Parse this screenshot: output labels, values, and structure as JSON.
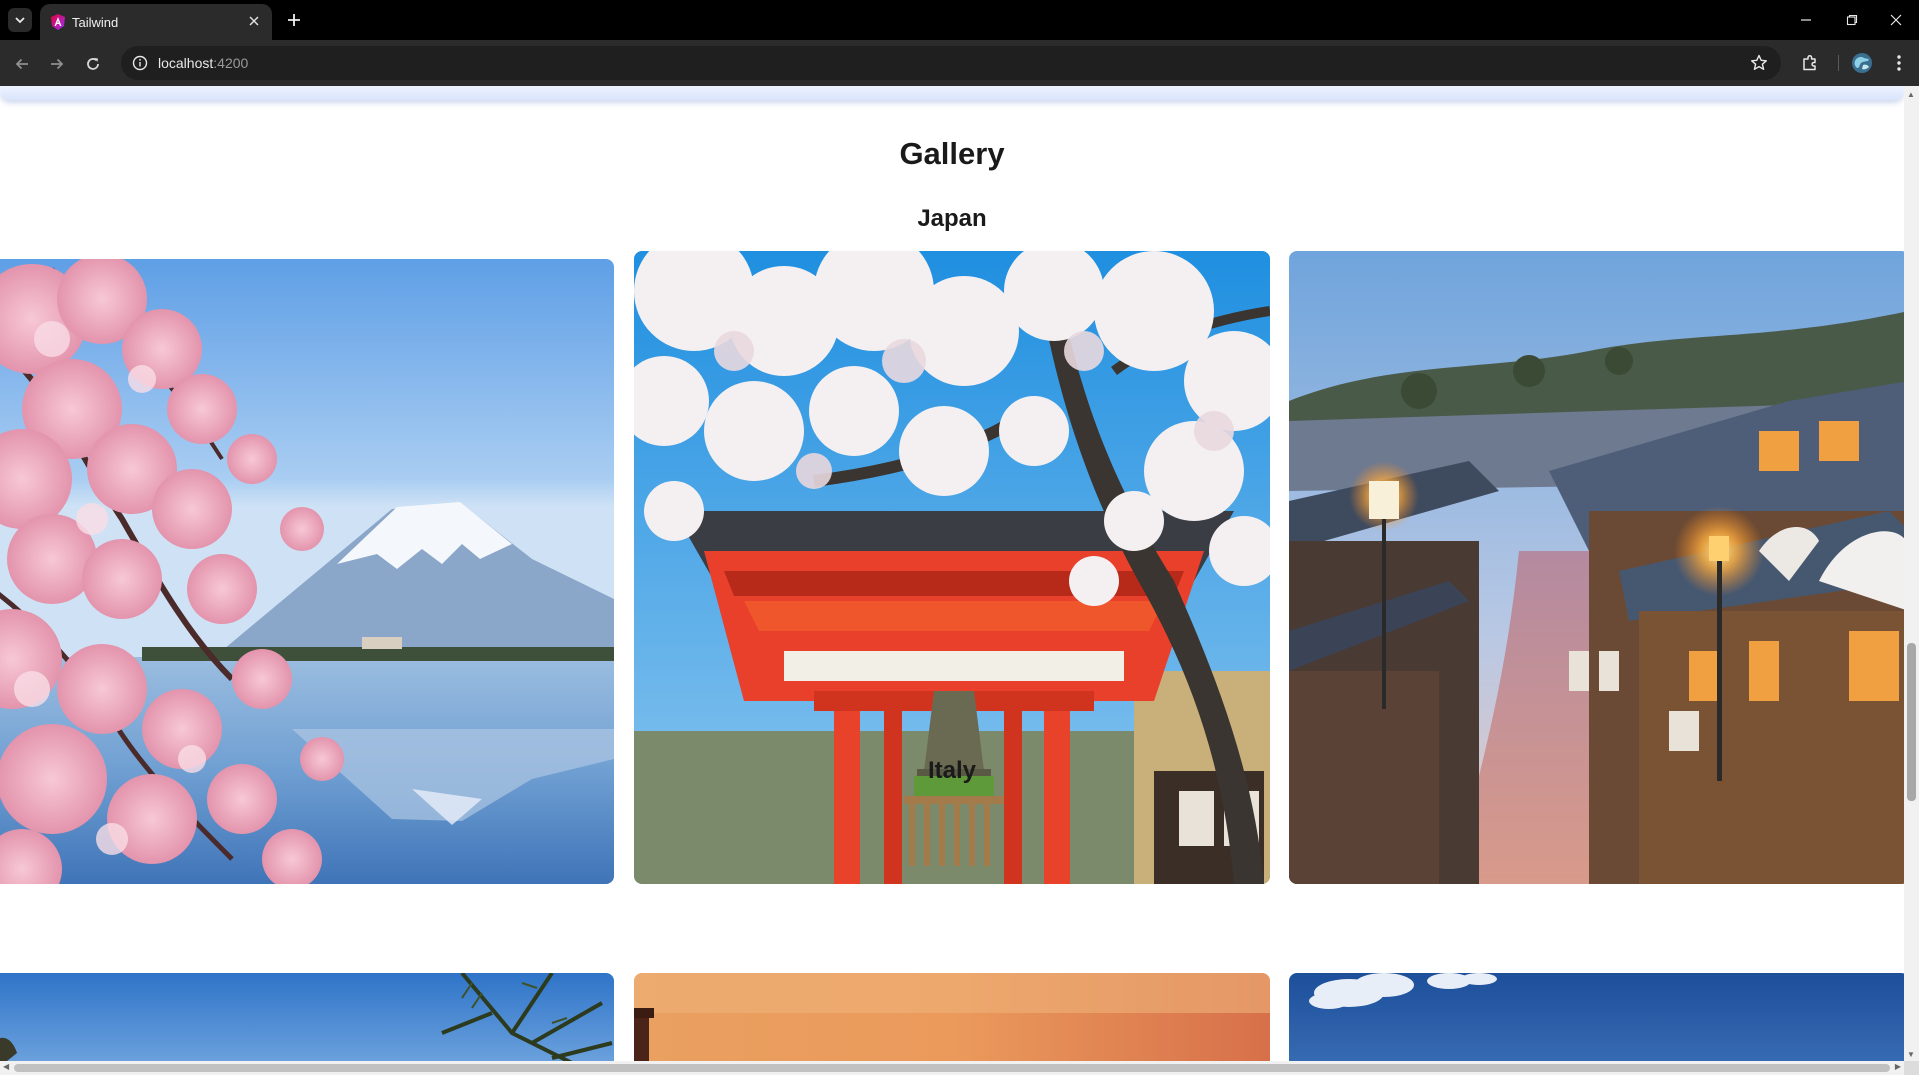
{
  "browser": {
    "tab_title": "Tailwind",
    "url_host": "localhost",
    "url_port": ":4200",
    "icons": {
      "tab_dropdown": "chevron-down-icon",
      "favicon": "angular-logo-icon",
      "tab_close": "close-icon",
      "new_tab": "plus-icon",
      "back": "arrow-left-icon",
      "forward": "arrow-right-icon",
      "reload": "reload-icon",
      "site_info": "info-icon",
      "bookmark": "star-icon",
      "extensions": "puzzle-icon",
      "profile": "profile-avatar-icon",
      "menu": "kebab-menu-icon",
      "minimize": "minimize-icon",
      "restore": "restore-icon",
      "close_window": "close-icon"
    }
  },
  "page": {
    "title": "Gallery",
    "sections": [
      {
        "title": "Japan",
        "photos": [
          {
            "subject": "cherry-blossoms-mount-fuji-lake"
          },
          {
            "subject": "red-bell-pavilion-cherry-blossoms"
          },
          {
            "subject": "kyoto-old-street-dusk"
          }
        ]
      },
      {
        "title": "Italy",
        "photos": [
          {
            "subject": "blue-sky-palm"
          },
          {
            "subject": "orange-sunset-tower"
          },
          {
            "subject": "blue-sky-clouds"
          }
        ]
      }
    ]
  },
  "colors": {
    "browser_frame": "#000000",
    "toolbar": "#2b2b2b",
    "omnibox": "#1f1f1f",
    "page_background": "#ffffff",
    "heading_text": "#1a1a1a"
  }
}
